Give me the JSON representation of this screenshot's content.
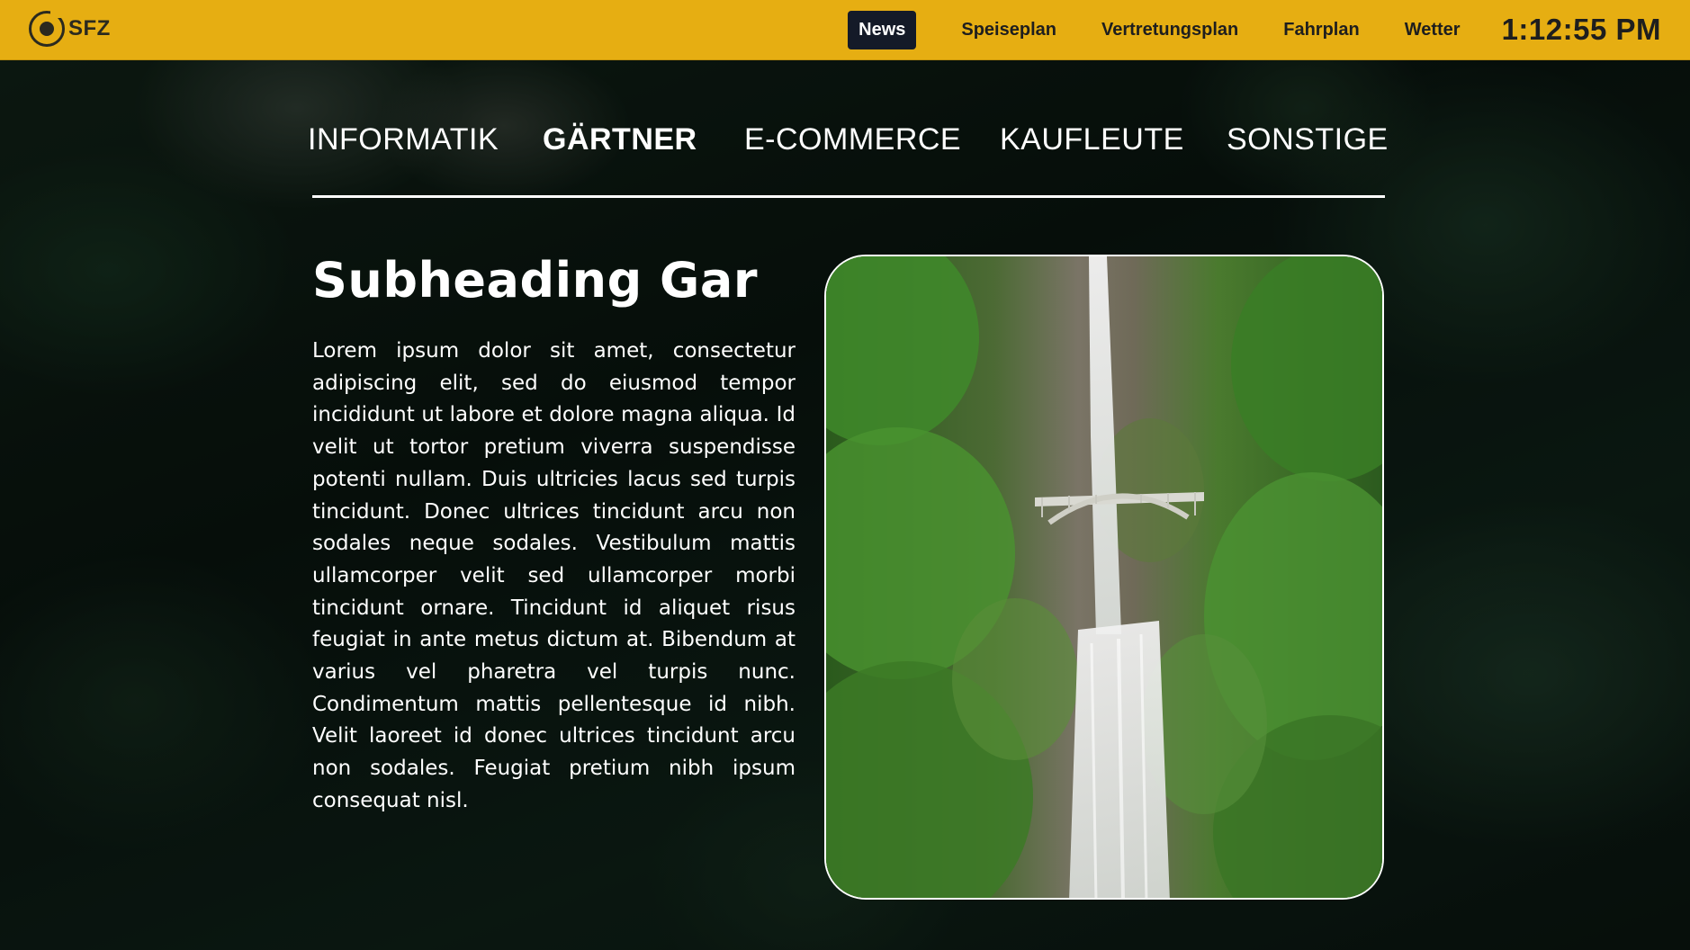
{
  "header": {
    "logo_text": "SFZ",
    "nav": [
      {
        "label": "News",
        "active": true
      },
      {
        "label": "Speiseplan",
        "active": false
      },
      {
        "label": "Vertretungsplan",
        "active": false
      },
      {
        "label": "Fahrplan",
        "active": false
      },
      {
        "label": "Wetter",
        "active": false
      }
    ],
    "clock": "1:12:55 PM"
  },
  "categories": [
    {
      "label": "INFORMATIK",
      "active": false
    },
    {
      "label": "GÄRTNER",
      "active": true
    },
    {
      "label": "E-COMMERCE",
      "active": false
    },
    {
      "label": "KAUFLEUTE",
      "active": false
    },
    {
      "label": "SONSTIGE",
      "active": false
    }
  ],
  "article": {
    "subheading": "Subheading Gar",
    "body": "Lorem ipsum dolor sit amet, consectetur adipiscing elit, sed do eiusmod tempor incididunt ut labore et dolore magna aliqua. Id velit ut tortor pretium viverra suspendisse potenti nullam. Duis ultricies lacus sed turpis tincidunt. Donec ultrices tincidunt arcu non sodales neque sodales. Vestibulum mattis ullamcorper velit sed ullamcorper morbi tincidunt ornare. Tincidunt id aliquet risus feugiat in ante metus dictum at. Bibendum at varius vel pharetra vel turpis nunc. Condimentum mattis pellentesque id nibh. Velit laoreet id donec ultrices tincidunt arcu non sodales. Feugiat pretium nibh ipsum consequat nisl.",
    "image": "waterfall-photo"
  },
  "colors": {
    "header_bg": "#e6ae12",
    "active_nav_bg": "#141a28",
    "text_light": "#ffffff"
  }
}
